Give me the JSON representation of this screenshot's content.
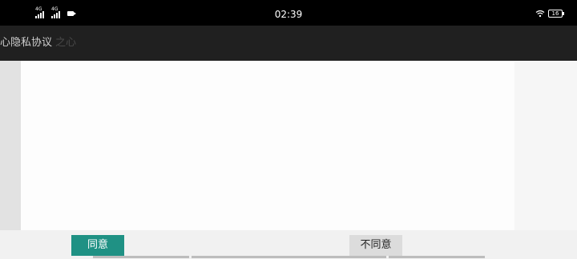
{
  "status_bar": {
    "time": "02:39",
    "sim1_tag": "4G",
    "sim2_tag": "4G",
    "battery_level": "16",
    "icons": [
      "signal-icon",
      "signal-icon",
      "video-icon",
      "wifi-icon",
      "battery-icon"
    ]
  },
  "app_bar": {
    "title": "心隐私协议",
    "faded_title": "之心"
  },
  "buttons": {
    "agree": "同意",
    "disagree": "不同意"
  },
  "colors": {
    "agree_button": "#1f9184",
    "disagree_button": "#dcdcdc",
    "app_bar": "#202020",
    "status_bar": "#000000"
  }
}
